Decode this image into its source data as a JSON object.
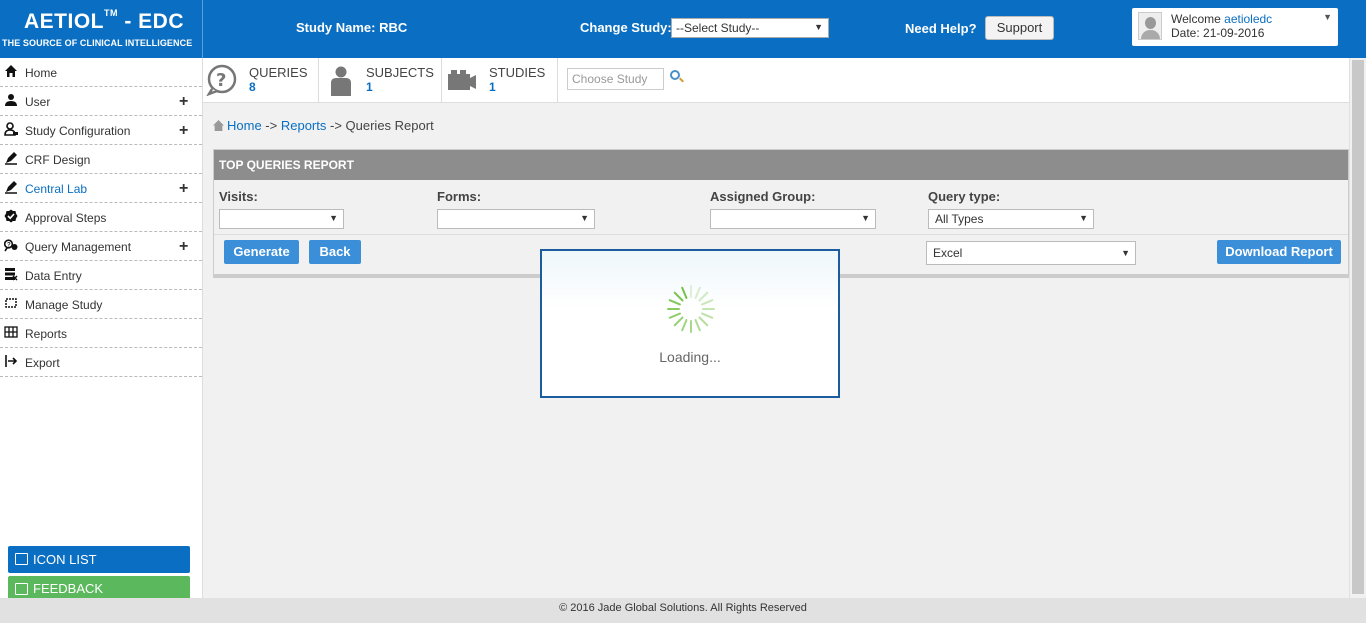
{
  "header": {
    "logo_main": "AETIOL",
    "logo_tm": "TM",
    "logo_suffix": " - EDC",
    "logo_tagline": "THE SOURCE OF CLINICAL INTELLIGENCE",
    "study_name": "Study Name: RBC",
    "change_study_label": "Change Study:",
    "study_select_value": "--Select Study--",
    "need_help": "Need Help?",
    "support_label": "Support",
    "welcome_prefix": "Welcome ",
    "username": "aetioledc",
    "date": "Date: 21-09-2016"
  },
  "sidebar": {
    "items": [
      {
        "label": "Home",
        "plus": ""
      },
      {
        "label": "User",
        "plus": "+"
      },
      {
        "label": "Study Configuration",
        "plus": "+"
      },
      {
        "label": "CRF Design",
        "plus": ""
      },
      {
        "label": "Central Lab",
        "plus": "+"
      },
      {
        "label": "Approval Steps",
        "plus": ""
      },
      {
        "label": "Query Management",
        "plus": "+"
      },
      {
        "label": "Data Entry",
        "plus": ""
      },
      {
        "label": "Manage Study",
        "plus": ""
      },
      {
        "label": "Reports",
        "plus": ""
      },
      {
        "label": "Export",
        "plus": ""
      }
    ],
    "icon_list_label": "ICON LIST",
    "feedback_label": "FEEDBACK"
  },
  "stats": {
    "queries": {
      "label": "QUERIES",
      "value": "8"
    },
    "subjects": {
      "label": "SUBJECTS",
      "value": "1"
    },
    "studies": {
      "label": "STUDIES",
      "value": "1"
    },
    "choose_study_placeholder": "Choose Study"
  },
  "breadcrumb": {
    "home": "Home",
    "sep1": " -> ",
    "reports": "Reports",
    "sep2": " -> ",
    "current": "Queries Report"
  },
  "panel": {
    "title": "TOP QUERIES REPORT",
    "visits_label": "Visits:",
    "visits_value": "",
    "forms_label": "Forms:",
    "forms_value": "",
    "group_label": "Assigned Group:",
    "group_value": "",
    "query_type_label": "Query type:",
    "query_type_value": "All Types",
    "generate_label": "Generate",
    "back_label": "Back",
    "format_value": "Excel",
    "download_label": "Download Report"
  },
  "loading": {
    "text": "Loading..."
  },
  "footer": {
    "text": "© 2016 Jade Global Solutions. All Rights Reserved"
  },
  "colors": {
    "primary": "#0a6fc2",
    "button": "#3b8fd9",
    "feedback": "#5cb85c",
    "panel_header": "#8d8d8d",
    "spinner": "#6cbf3d"
  }
}
